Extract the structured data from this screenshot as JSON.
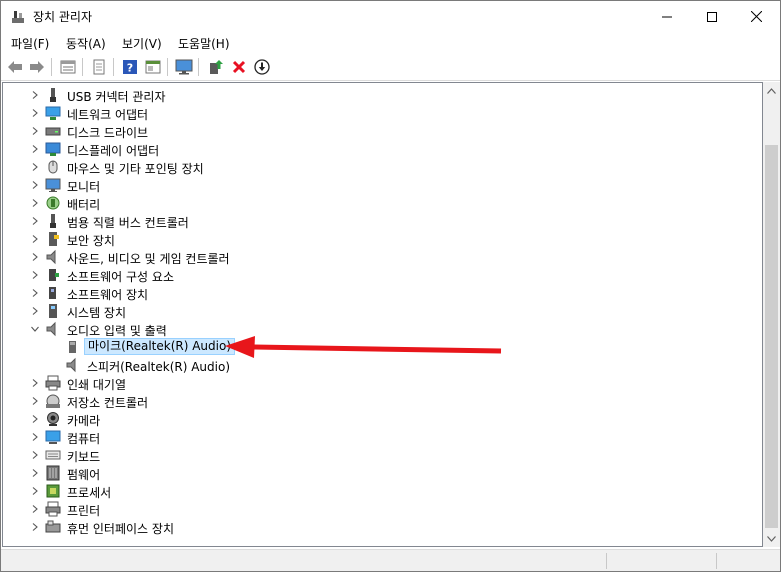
{
  "window": {
    "title": "장치 관리자"
  },
  "menu": [
    {
      "label": "파일(F)"
    },
    {
      "label": "동작(A)"
    },
    {
      "label": "보기(V)"
    },
    {
      "label": "도움말(H)"
    }
  ],
  "toolbar": {
    "buttons": [
      "back-icon",
      "forward-icon",
      "properties-icon",
      "list-icon",
      "help-icon",
      "console-icon",
      "monitor-icon",
      "update-driver-icon",
      "uninstall-icon",
      "disable-icon"
    ]
  },
  "tree": [
    {
      "label": "USB 커넥터 관리자",
      "expanded": false,
      "icon": "usb-icon",
      "level": 0
    },
    {
      "label": "네트워크 어댑터",
      "expanded": false,
      "icon": "network-icon",
      "level": 0
    },
    {
      "label": "디스크 드라이브",
      "expanded": false,
      "icon": "disk-icon",
      "level": 0
    },
    {
      "label": "디스플레이 어댑터",
      "expanded": false,
      "icon": "display-icon",
      "level": 0
    },
    {
      "label": "마우스 및 기타 포인팅 장치",
      "expanded": false,
      "icon": "mouse-icon",
      "level": 0
    },
    {
      "label": "모니터",
      "expanded": false,
      "icon": "monitor-icon",
      "level": 0
    },
    {
      "label": "배터리",
      "expanded": false,
      "icon": "battery-icon",
      "level": 0
    },
    {
      "label": "범용 직렬 버스 컨트롤러",
      "expanded": false,
      "icon": "usb-icon",
      "level": 0
    },
    {
      "label": "보안 장치",
      "expanded": false,
      "icon": "security-icon",
      "level": 0
    },
    {
      "label": "사운드, 비디오 및 게임 컨트롤러",
      "expanded": false,
      "icon": "speaker-icon",
      "level": 0
    },
    {
      "label": "소프트웨어 구성 요소",
      "expanded": false,
      "icon": "software-component-icon",
      "level": 0
    },
    {
      "label": "소프트웨어 장치",
      "expanded": false,
      "icon": "software-device-icon",
      "level": 0
    },
    {
      "label": "시스템 장치",
      "expanded": false,
      "icon": "system-icon",
      "level": 0
    },
    {
      "label": "오디오 입력 및 출력",
      "expanded": true,
      "icon": "speaker-icon",
      "level": 0
    },
    {
      "label": "마이크(Realtek(R) Audio)",
      "icon": "microphone-icon",
      "level": 1,
      "selected": true
    },
    {
      "label": "스피커(Realtek(R) Audio)",
      "icon": "speaker-icon",
      "level": 1
    },
    {
      "label": "인쇄 대기열",
      "expanded": false,
      "icon": "printer-icon",
      "level": 0
    },
    {
      "label": "저장소 컨트롤러",
      "expanded": false,
      "icon": "storage-icon",
      "level": 0
    },
    {
      "label": "카메라",
      "expanded": false,
      "icon": "camera-icon",
      "level": 0
    },
    {
      "label": "컴퓨터",
      "expanded": false,
      "icon": "computer-icon",
      "level": 0
    },
    {
      "label": "키보드",
      "expanded": false,
      "icon": "keyboard-icon",
      "level": 0
    },
    {
      "label": "펌웨어",
      "expanded": false,
      "icon": "firmware-icon",
      "level": 0
    },
    {
      "label": "프로세서",
      "expanded": false,
      "icon": "processor-icon",
      "level": 0
    },
    {
      "label": "프린터",
      "expanded": false,
      "icon": "printer-icon",
      "level": 0
    },
    {
      "label": "휴먼 인터페이스 장치",
      "expanded": false,
      "icon": "hid-icon",
      "level": 0
    }
  ],
  "colors": {
    "selection": "#cce8ff",
    "annotation_arrow": "#e8161b"
  }
}
